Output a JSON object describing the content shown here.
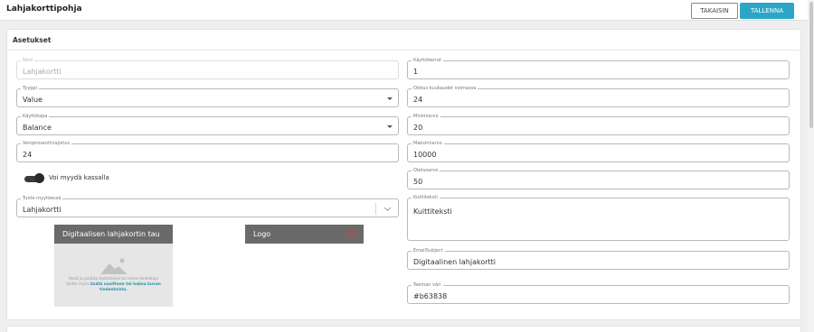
{
  "header": {
    "title": "Lahjakorttipohja",
    "back_label": "TAKAISIN",
    "save_label": "TALLENNA"
  },
  "settings": {
    "title": "Asetukset",
    "left": {
      "name": {
        "label": "Nimi",
        "value": "Lahjakortti",
        "disabled": true
      },
      "type": {
        "label": "Tyyppi",
        "value": "Value"
      },
      "usage": {
        "label": "Käyttötapa",
        "value": "Balance"
      },
      "tax": {
        "label": "Veroprosenttirajoitus",
        "value": "24"
      },
      "sell_toggle": {
        "label": "Voi myydä kassalla",
        "checked": true
      },
      "product": {
        "label": "Tuote myytäessä",
        "value": "Lahjakortti"
      }
    },
    "right": {
      "uses": {
        "label": "Käyttökerrat",
        "value": "1"
      },
      "validity": {
        "label": "Oletus kuukaudet voimassa",
        "value": "24"
      },
      "min": {
        "label": "Minimiarvo",
        "value": "20"
      },
      "max": {
        "label": "Maksimiarvo",
        "value": "10000"
      },
      "default": {
        "label": "Oletusarvo",
        "value": "50"
      },
      "receipt": {
        "label": "Kuittiteksti",
        "value": "Kuittiteksti"
      },
      "email_subject": {
        "label": "EmailSubject",
        "value": "Digitaalinen lahjakortti"
      },
      "theme_color": {
        "label": "Teeman väri",
        "value": "#b63838"
      }
    },
    "image_upload": {
      "title": "Digitaalisen lahjakortin tau",
      "help_line1": "Vedä ja pudota tadostoiesi tai selaa tiedostoja",
      "help_line2_prefix": "Voitte myös ",
      "help_line2_link": "lisätä osoitteen tai hakea kuvan",
      "help_line3_link": "tiedostoista."
    },
    "logo": {
      "title": "Logo"
    }
  },
  "colors": {
    "accent": "#2ba6c7",
    "remove": "#e33a3a"
  }
}
